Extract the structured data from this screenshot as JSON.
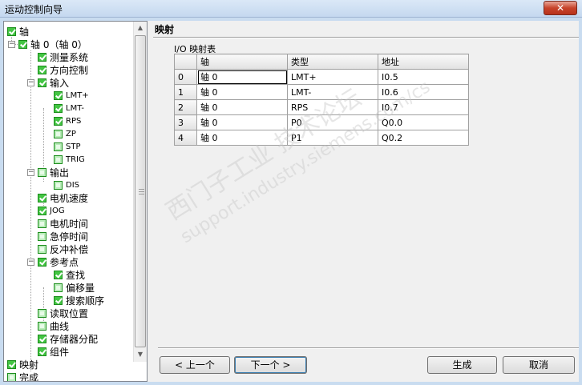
{
  "window": {
    "title": "运动控制向导",
    "close_glyph": "✕"
  },
  "tree": {
    "root": "轴",
    "axis0": "轴 0（轴 0）",
    "measure": "测量系统",
    "direction": "方向控制",
    "input": "输入",
    "lmt_plus": "LMT+",
    "lmt_minus": "LMT-",
    "rps": "RPS",
    "zp": "ZP",
    "stp": "STP",
    "trig": "TRIG",
    "output": "输出",
    "dis": "DIS",
    "motor_speed": "电机速度",
    "jog": "JOG",
    "motor_time": "电机时间",
    "estop_time": "急停时间",
    "backlash": "反冲补偿",
    "ref_point": "参考点",
    "search": "查找",
    "offset": "偏移量",
    "search_order": "搜索顺序",
    "read_pos": "读取位置",
    "curve": "曲线",
    "memory": "存储器分配",
    "component": "组件",
    "mapping": "映射",
    "finish": "完成"
  },
  "panel": {
    "heading": "映射",
    "table_caption": "I/O 映射表",
    "columns": [
      "轴",
      "类型",
      "地址"
    ],
    "rows": [
      {
        "index": "0",
        "axis": "轴 0",
        "type": "LMT+",
        "address": "I0.5"
      },
      {
        "index": "1",
        "axis": "轴 0",
        "type": "LMT-",
        "address": "I0.6"
      },
      {
        "index": "2",
        "axis": "轴 0",
        "type": "RPS",
        "address": "I0.7"
      },
      {
        "index": "3",
        "axis": "轴 0",
        "type": "P0",
        "address": "Q0.0"
      },
      {
        "index": "4",
        "axis": "轴 0",
        "type": "P1",
        "address": "Q0.2"
      }
    ]
  },
  "watermark": {
    "line1": "西门子工业  技术论坛",
    "line2": "support.industry.siemens.com/cs"
  },
  "buttons": {
    "prev": "< 上一个",
    "next": "下一个 >",
    "generate": "生成",
    "cancel": "取消"
  },
  "colors": {
    "check_green": "#43c543",
    "titlebar": "#c4d8ef",
    "close_red": "#c7432b"
  }
}
